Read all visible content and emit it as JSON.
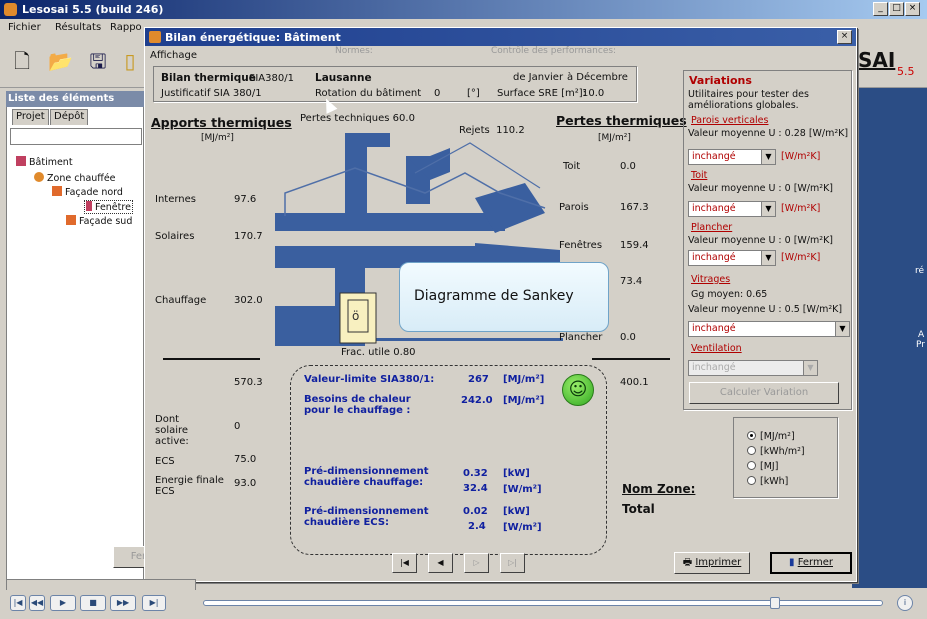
{
  "app": {
    "title": "Lesosai 5.5 (build 246)",
    "menus": [
      "Fichier",
      "Résultats",
      "Rappo"
    ],
    "brand": "SAI",
    "brand_version": "5.5"
  },
  "left_panel": {
    "header": "Liste des éléments",
    "tabs": [
      "Projet",
      "Dépôt"
    ],
    "tree": [
      "Bâtiment",
      "Zone chauffée",
      "Façade nord",
      "Fenêtre",
      "Façade sud"
    ],
    "close_label": "Fermer"
  },
  "dialog": {
    "title": "Bilan énergétique: Bâtiment",
    "affichage": "Affichage",
    "normes": "Normes:",
    "controle": "Contrôle des performances:",
    "bilan_label": "Bilan thermique",
    "bilan_norme": "SIA380/1",
    "justificatif": "Justificatif SIA 380/1",
    "location": "Lausanne",
    "rotation_label": "Rotation du bâtiment",
    "rotation_value": "0",
    "rotation_unit": "[°]",
    "period_from": "de Janvier",
    "period_to": "à Décembre",
    "sre_label": "Surface SRE [m²]:",
    "sre_value": "10.0"
  },
  "apports": {
    "title": "Apports thermiques",
    "unit": "[MJ/m²]",
    "rows": [
      {
        "label": "Internes",
        "value": "97.6"
      },
      {
        "label": "Solaires",
        "value": "170.7"
      },
      {
        "label": "Chauffage",
        "value": "302.0"
      }
    ],
    "total": "570.3",
    "solaire_active_label": "Dont solaire active:",
    "solaire_active_value": "0",
    "ecs_label": "ECS",
    "ecs_value": "75.0",
    "ef_ecs_label": "Energie finale ECS",
    "ef_ecs_value": "93.0"
  },
  "sankey": {
    "pertes_techniques_label": "Pertes techniques",
    "pertes_techniques_value": "60.0",
    "rejets_label": "Rejets",
    "rejets_value": "110.2",
    "frac_utile_label": "Frac. utile",
    "frac_utile_value": "0.80",
    "tooltip": "Diagramme de Sankey"
  },
  "pertes": {
    "title": "Pertes thermiques",
    "unit": "[MJ/m²]",
    "rows": [
      {
        "label": "Toit",
        "value": "0.0"
      },
      {
        "label": "Parois",
        "value": "167.3"
      },
      {
        "label": "Fenêtres",
        "value": "159.4"
      },
      {
        "label": "",
        "value": "73.4"
      },
      {
        "label": "Plancher",
        "value": "0.0"
      }
    ],
    "total": "400.1"
  },
  "results": {
    "valeur_limite_label": "Valeur-limite SIA380/1:",
    "valeur_limite_value": "267",
    "valeur_limite_unit": "[MJ/m²]",
    "besoins_label": "Besoins de chaleur pour le chauffage :",
    "besoins_value": "242.0",
    "besoins_unit": "[MJ/m²]",
    "predim_chauffage_label": "Pré-dimensionnement chaudière chauffage:",
    "predim_chauffage_v1": "0.32",
    "predim_chauffage_u1": "[kW]",
    "predim_chauffage_v2": "32.4",
    "predim_chauffage_u2": "[W/m²]",
    "predim_ecs_label": "Pré-dimensionnement chaudière ECS:",
    "predim_ecs_v1": "0.02",
    "predim_ecs_u1": "[kW]",
    "predim_ecs_v2": "2.4",
    "predim_ecs_u2": "[W/m²]",
    "nom_zone_label": "Nom Zone:",
    "nom_zone_value": "Total"
  },
  "variations": {
    "title": "Variations",
    "description": "Utilitaires pour tester des améliorations globales.",
    "parois_title": "Parois verticales",
    "parois_u": "Valeur moyenne U : 0.28 [W/m²K]",
    "parois_sel": "inchangé",
    "parois_unit": "[W/m²K]",
    "toit_title": "Toit",
    "toit_u": "Valeur moyenne U : 0     [W/m²K]",
    "toit_sel": "inchangé",
    "toit_unit": "[W/m²K]",
    "plancher_title": "Plancher",
    "plancher_u": "Valeur moyenne U : 0     [W/m²K]",
    "plancher_sel": "inchangé",
    "plancher_unit": "[W/m²K]",
    "vitrages_title": "Vitrages",
    "vitrages_g": "Gg moyen: 0.65",
    "vitrages_u": "Valeur moyenne U : 0.5 [W/m²K]",
    "vitrages_sel": "inchangé",
    "ventilation_title": "Ventilation",
    "ventilation_sel": "inchangé",
    "calc_button": "Calculer Variation"
  },
  "units": {
    "options": [
      "[MJ/m²]",
      "[kWh/m²]",
      "[MJ]",
      "[kWh]"
    ],
    "selected": 0
  },
  "buttons": {
    "imprimer": "Imprimer",
    "fermer": "Fermer"
  },
  "right_side": {
    "r1": "ré",
    "r2": "A",
    "r3": "Pr"
  }
}
